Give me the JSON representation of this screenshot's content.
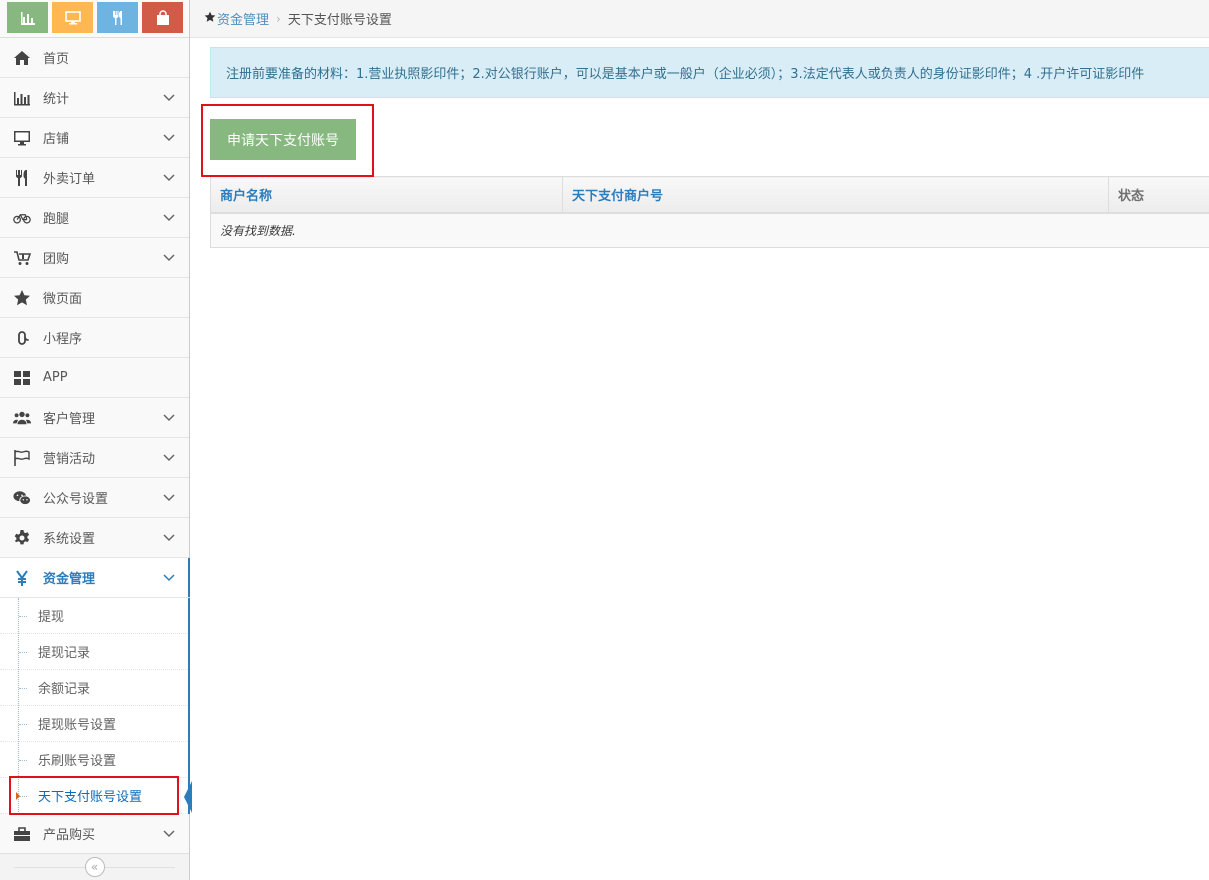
{
  "shortcuts": [
    {
      "name": "chart-icon",
      "color": "#87b87f"
    },
    {
      "name": "monitor-icon",
      "color": "#ffb752"
    },
    {
      "name": "utensils-icon",
      "color": "#6fb3e0"
    },
    {
      "name": "shopping-bag-icon",
      "color": "#d15b47"
    }
  ],
  "nav": [
    {
      "label": "首页",
      "icon": "home-icon"
    },
    {
      "label": "统计",
      "icon": "bar-chart-icon"
    },
    {
      "label": "店铺",
      "icon": "desktop-icon"
    },
    {
      "label": "外卖订单",
      "icon": "cutlery-icon"
    },
    {
      "label": "跑腿",
      "icon": "bicycle-icon"
    },
    {
      "label": "团购",
      "icon": "cart-icon"
    },
    {
      "label": "微页面",
      "icon": "star-icon"
    },
    {
      "label": "小程序",
      "icon": "link-icon"
    },
    {
      "label": "APP",
      "icon": "grid-icon"
    },
    {
      "label": "客户管理",
      "icon": "users-icon"
    },
    {
      "label": "营销活动",
      "icon": "flag-icon"
    },
    {
      "label": "公众号设置",
      "icon": "wechat-icon"
    },
    {
      "label": "系统设置",
      "icon": "gear-icon"
    },
    {
      "label": "资金管理",
      "icon": "yen-icon"
    },
    {
      "label": "产品购买",
      "icon": "briefcase-icon"
    }
  ],
  "submenu": [
    "提现",
    "提现记录",
    "余额记录",
    "提现账号设置",
    "乐刷账号设置",
    "天下支付账号设置"
  ],
  "breadcrumb": {
    "parent": "资金管理",
    "current": "天下支付账号设置"
  },
  "alert": "注册前要准备的材料：1.营业执照影印件；2.对公银行账户，可以是基本户或一般户（企业必须）；3.法定代表人或负责人的身份证影印件；4 .开户许可证影印件",
  "apply_button": "申请天下支付账号",
  "table": {
    "headers": [
      "商户名称",
      "天下支付商户号",
      "状态"
    ],
    "empty_text": "没有找到数据."
  },
  "colors": {
    "accent": "#2b7dbc",
    "success": "#87b87f",
    "alert_bg": "#d9edf7",
    "highlight": "#e0111a"
  }
}
